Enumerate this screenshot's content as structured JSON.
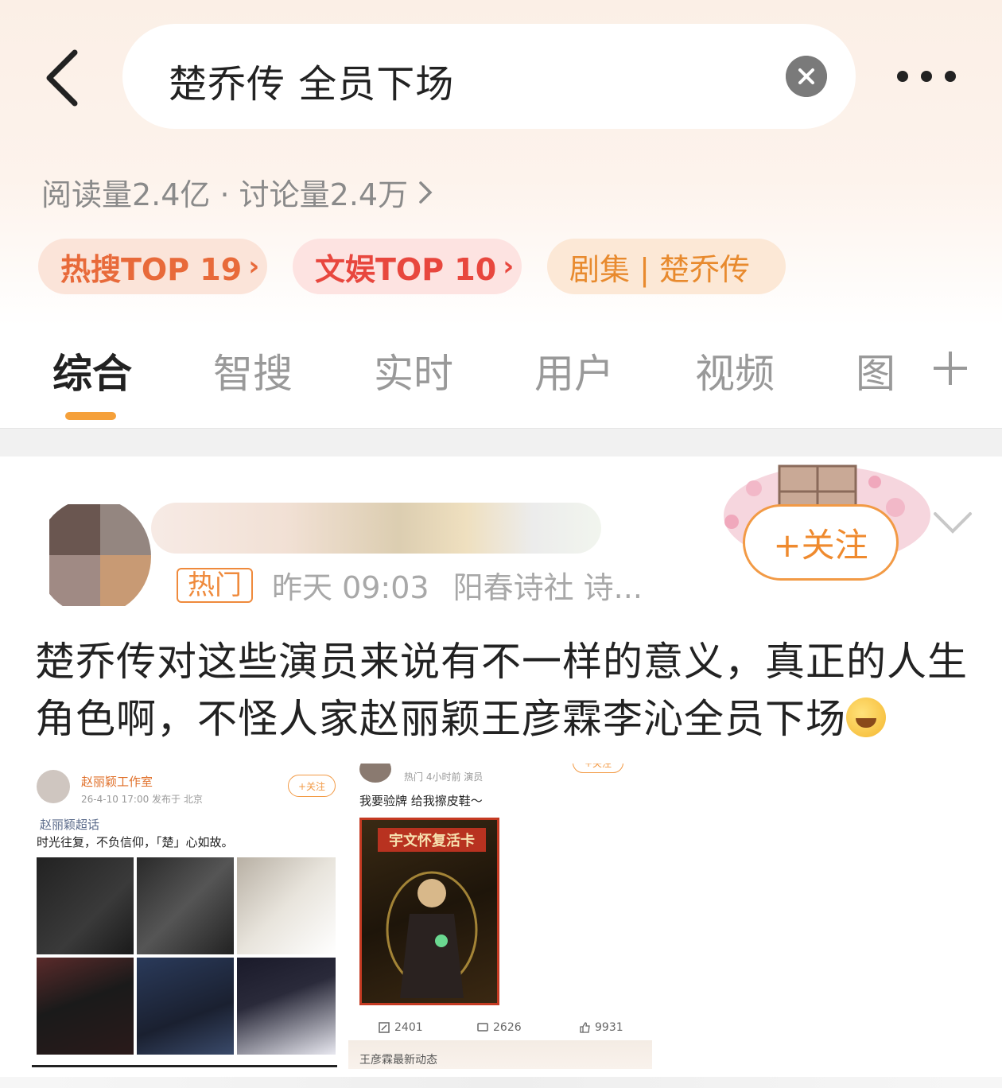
{
  "search": {
    "query": "楚乔传 全员下场"
  },
  "stats": {
    "text": "阅读量2.4亿 · 讨论量2.4万"
  },
  "chips": {
    "hot_label": "热搜TOP 19",
    "ent_label": "文娱TOP 10",
    "drama_label": "剧集 | 楚乔传"
  },
  "tabs": [
    {
      "label": "综合"
    },
    {
      "label": "智搜"
    },
    {
      "label": "实时"
    },
    {
      "label": "用户"
    },
    {
      "label": "视频"
    },
    {
      "label": "图"
    }
  ],
  "post": {
    "badge": "热门",
    "time": "昨天 09:03",
    "source": "阳春诗社 诗...",
    "follow_label": "+关注",
    "text": "楚乔传对这些演员来说有不一样的意义，真正的人生角色啊，不怪人家赵丽颖王彦霖李沁全员下场"
  },
  "left_image": {
    "user": "赵丽颖工作室",
    "meta": "26-4-10 17:00  发布于 北京",
    "follow": "+关注",
    "topic": "赵丽颖超话",
    "caption": "时光往复，不负信仰，「楚」心如故。"
  },
  "right_image": {
    "meta": "热门  4小时前  演员",
    "follow": "+关注",
    "caption": "我要验牌 给我擦皮鞋～",
    "card_title": "宇文怀复活卡",
    "reposts": "2401",
    "comments": "2626",
    "likes": "9931",
    "next_label": "王彦霖最新动态"
  },
  "colors": {
    "accent": "#f5a03a",
    "follow": "#ef8a2e",
    "hot_chip": "#e86a3a",
    "ent_chip": "#e8473e",
    "drama_chip": "#e88a2e"
  },
  "icons": {
    "back": "back-chevron-icon",
    "clear": "clear-icon",
    "more": "more-icon",
    "plus": "plus-icon",
    "collapse": "chevron-down-icon"
  }
}
